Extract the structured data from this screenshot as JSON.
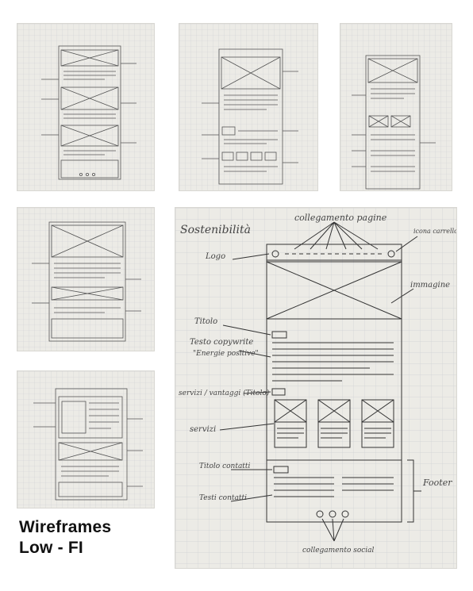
{
  "caption": {
    "line1": "Wireframes",
    "line2": "Low - FI"
  },
  "large_sketch": {
    "page_title": "Sostenibilità",
    "notes": {
      "page_links": "collegamento pagine",
      "cart_icon": "icona carrello",
      "logo": "Logo",
      "image": "immagine",
      "title": "Titolo",
      "copy_text": "Testo copywrite",
      "copy_quote": "\"Energie positive\"",
      "services_title": "servizi / vantaggi (Titolo)",
      "services": "servizi",
      "contact_title": "Titolo contatti",
      "contact_text": "Testi contatti",
      "footer": "Footer",
      "social_links": "collegamento social"
    }
  },
  "thumbnails": [
    {
      "id": "home-wireframe"
    },
    {
      "id": "services-wireframe"
    },
    {
      "id": "listing-wireframe"
    },
    {
      "id": "detail-wireframe"
    },
    {
      "id": "form-wireframe"
    }
  ],
  "colors": {
    "paper": "#ecebe6",
    "grid": "#cfd1d4",
    "ink": "#3a3a3a"
  }
}
